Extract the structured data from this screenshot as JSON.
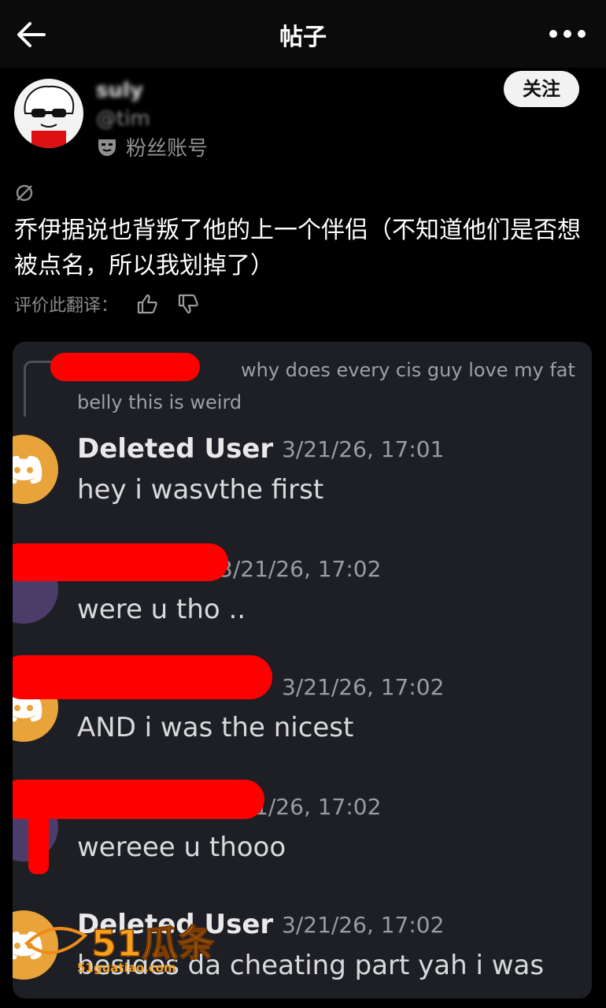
{
  "header": {
    "title": "帖子"
  },
  "author": {
    "name": "suly",
    "handle": "@tim",
    "account_type": "粉丝账号",
    "follow_label": "关注"
  },
  "post": {
    "text": "乔伊据说也背叛了他的上一个伴侣（不知道他们是否想被点名，所以我划掉了）",
    "rate_label": "评价此翻译："
  },
  "screenshot": {
    "reply_preview": "why does every cis guy love my fat belly this is weird",
    "messages": [
      {
        "author": "Deleted User",
        "time": "3/21/26, 17:01",
        "text": "hey i wasvthe first"
      },
      {
        "author": "",
        "time": "3/21/26, 17:02",
        "text": "were u tho .."
      },
      {
        "author": "",
        "time": "3/21/26, 17:02",
        "text": "AND i was the nicest"
      },
      {
        "author": "",
        "time": "3/21/26, 17:02",
        "text": "wereee u thooo"
      },
      {
        "author": "Deleted User",
        "time": "3/21/26, 17:02",
        "text": "besides da cheating part yah i was"
      }
    ]
  },
  "watermark": {
    "brand": "51瓜条",
    "site": "51guatiao.com"
  },
  "colors": {
    "redaction": "#ff0000",
    "discord_avatar": "#e8a43a",
    "card_bg": "#1e1f24"
  }
}
